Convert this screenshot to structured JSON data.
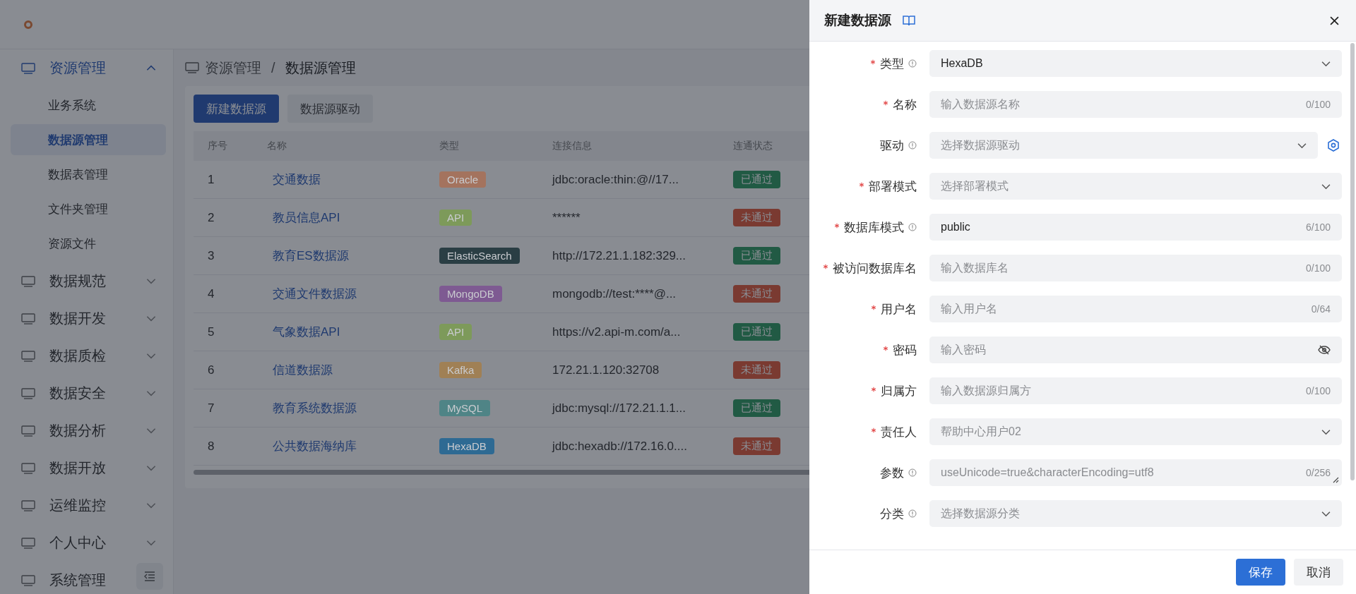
{
  "sidebar": {
    "menus": [
      {
        "label": "资源管理",
        "expanded": true,
        "children": [
          {
            "label": "业务系统",
            "selected": false
          },
          {
            "label": "数据源管理",
            "selected": true
          },
          {
            "label": "数据表管理",
            "selected": false
          },
          {
            "label": "文件夹管理",
            "selected": false
          },
          {
            "label": "资源文件",
            "selected": false
          }
        ]
      },
      {
        "label": "数据规范",
        "expanded": false
      },
      {
        "label": "数据开发",
        "expanded": false
      },
      {
        "label": "数据质检",
        "expanded": false
      },
      {
        "label": "数据安全",
        "expanded": false
      },
      {
        "label": "数据分析",
        "expanded": false
      },
      {
        "label": "数据开放",
        "expanded": false
      },
      {
        "label": "运维监控",
        "expanded": false
      },
      {
        "label": "个人中心",
        "expanded": false
      },
      {
        "label": "系统管理",
        "expanded": false
      }
    ]
  },
  "breadcrumb": [
    "资源管理",
    "/",
    "数据源管理"
  ],
  "toolbar": {
    "buttons": [
      {
        "label": "新建数据源",
        "kind": "primary"
      },
      {
        "label": "数据源驱动",
        "kind": "default"
      }
    ]
  },
  "table": {
    "columns": [
      "序号",
      "名称",
      "类型",
      "连接信息",
      "连通状态"
    ],
    "rows": [
      {
        "index": "1",
        "name": "交通数据",
        "type": {
          "label": "Oracle",
          "color": "#a4735e"
        },
        "connection": "jdbc:oracle:thin:@//17...",
        "status": {
          "label": "已通过",
          "passed": true
        }
      },
      {
        "index": "2",
        "name": "教员信息API",
        "type": {
          "label": "API",
          "color": "#7d9a5a"
        },
        "connection": "******",
        "status": {
          "label": "未通过",
          "passed": false
        }
      },
      {
        "index": "3",
        "name": "教育ES数据源",
        "type": {
          "label": "ElasticSearch",
          "color": "#2a3e44"
        },
        "connection": "http://172.21.1.182:329...",
        "status": {
          "label": "已通过",
          "passed": true
        }
      },
      {
        "index": "4",
        "name": "交通文件数据源",
        "type": {
          "label": "MongoDB",
          "color": "#7e5a92"
        },
        "connection": "mongodb://test:****@...",
        "status": {
          "label": "未通过",
          "passed": false
        }
      },
      {
        "index": "5",
        "name": "气象数据API",
        "type": {
          "label": "API",
          "color": "#7d9a5a"
        },
        "connection": "https://v2.api-m.com/a...",
        "status": {
          "label": "已通过",
          "passed": true
        }
      },
      {
        "index": "6",
        "name": "信道数据源",
        "type": {
          "label": "Kafka",
          "color": "#a08055"
        },
        "connection": "172.21.1.120:32708",
        "status": {
          "label": "未通过",
          "passed": false
        }
      },
      {
        "index": "7",
        "name": "教育系统数据源",
        "type": {
          "label": "MySQL",
          "color": "#4f8486"
        },
        "connection": "jdbc:mysql://172.21.1.1...",
        "status": {
          "label": "已通过",
          "passed": true
        }
      },
      {
        "index": "8",
        "name": "公共数据海纳库",
        "type": {
          "label": "HexaDB",
          "color": "#2e6a93"
        },
        "connection": "jdbc:hexadb://172.16.0....",
        "status": {
          "label": "未通过",
          "passed": false
        }
      }
    ]
  },
  "drawer": {
    "title": "新建数据源",
    "fields": [
      {
        "label": "类型",
        "required": true,
        "info": true,
        "kind": "select",
        "value": "HexaDB"
      },
      {
        "label": "名称",
        "required": true,
        "info": false,
        "kind": "input",
        "placeholder": "输入数据源名称",
        "counter": "0/100"
      },
      {
        "label": "驱动",
        "required": false,
        "info": true,
        "kind": "select",
        "placeholder": "选择数据源驱动",
        "settings": true
      },
      {
        "label": "部署模式",
        "required": true,
        "info": false,
        "kind": "select",
        "placeholder": "选择部署模式"
      },
      {
        "label": "数据库模式",
        "required": true,
        "info": true,
        "kind": "input",
        "value": "public",
        "counter": "6/100"
      },
      {
        "label": "被访问数据库名",
        "required": true,
        "info": false,
        "kind": "input",
        "placeholder": "输入数据库名",
        "counter": "0/100"
      },
      {
        "label": "用户名",
        "required": true,
        "info": false,
        "kind": "input",
        "placeholder": "输入用户名",
        "counter": "0/64"
      },
      {
        "label": "密码",
        "required": true,
        "info": false,
        "kind": "password",
        "placeholder": "输入密码"
      },
      {
        "label": "归属方",
        "required": true,
        "info": false,
        "kind": "input",
        "placeholder": "输入数据源归属方",
        "counter": "0/100"
      },
      {
        "label": "责任人",
        "required": true,
        "info": false,
        "kind": "select",
        "placeholder": "帮助中心用户02"
      },
      {
        "label": "参数",
        "required": false,
        "info": true,
        "kind": "textarea",
        "placeholder": "useUnicode=true&characterEncoding=utf8",
        "counter": "0/256"
      },
      {
        "label": "分类",
        "required": false,
        "info": true,
        "kind": "select",
        "placeholder": "选择数据源分类"
      }
    ],
    "buttons": [
      {
        "label": "保存",
        "kind": "primary"
      },
      {
        "label": "取消",
        "kind": "default"
      }
    ]
  }
}
